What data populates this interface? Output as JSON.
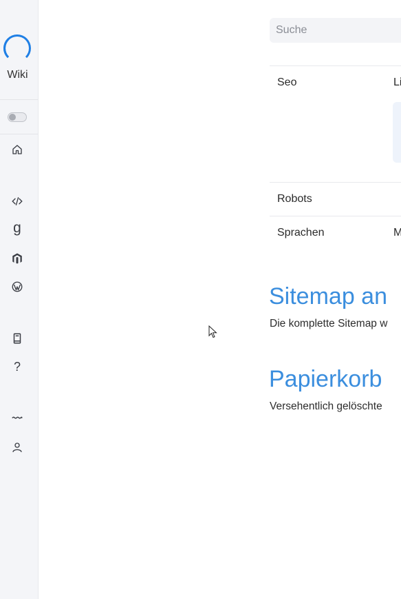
{
  "sidebar": {
    "logo_text": "Wiki",
    "icons": {
      "home": "home-icon",
      "code": "code-icon",
      "g": "g",
      "magento": "magento-icon",
      "wordpress": "wordpress-icon",
      "book": "book-icon",
      "help": "?",
      "wave": "wave-icon",
      "user": "user-icon"
    }
  },
  "search": {
    "placeholder": "Suche"
  },
  "table": {
    "rows": [
      {
        "label": "Seo",
        "value": "Li"
      },
      {
        "label": "Robots",
        "value": ""
      },
      {
        "label": "Sprachen",
        "value": "M"
      }
    ]
  },
  "sections": [
    {
      "title": "Sitemap an",
      "text": "Die komplette Sitemap w"
    },
    {
      "title": "Papierkorb",
      "text": "Versehentlich gelöschte"
    }
  ],
  "colors": {
    "accent": "#3b8ede",
    "logo": "#1f7fe5",
    "sidebar_bg": "#f4f5f8"
  }
}
